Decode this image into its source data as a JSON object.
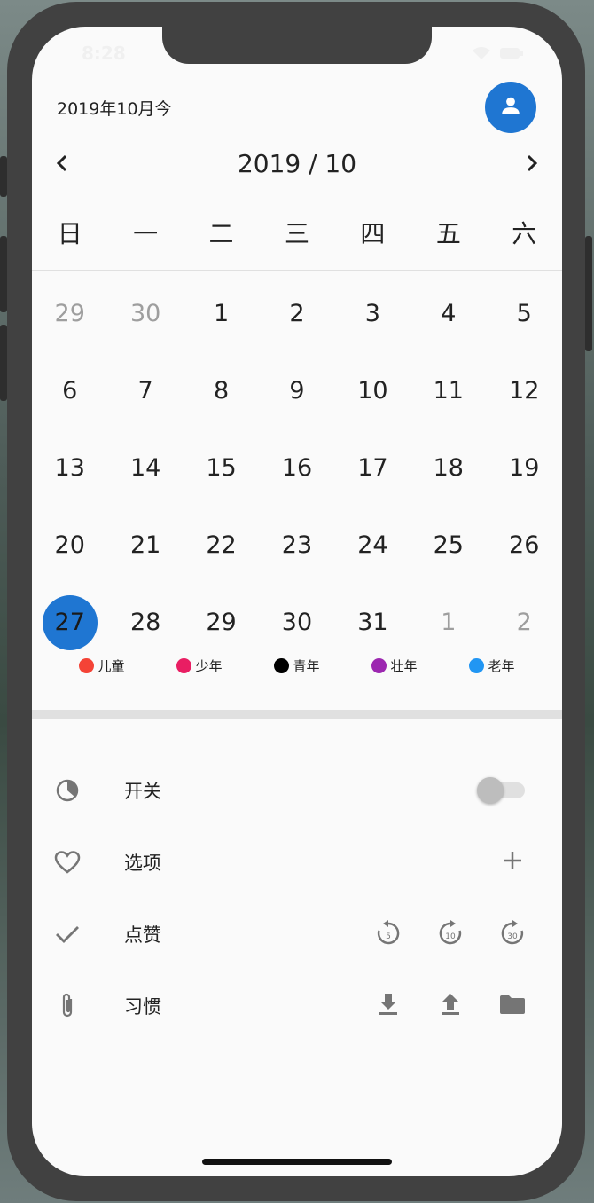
{
  "status": {
    "time": "8:28"
  },
  "header": {
    "date_label": "2019年10月今"
  },
  "nav": {
    "month_title": "2019 / 10"
  },
  "weekdays": [
    "日",
    "一",
    "二",
    "三",
    "四",
    "五",
    "六"
  ],
  "weeks": [
    [
      {
        "d": "29",
        "muted": true
      },
      {
        "d": "30",
        "muted": true
      },
      {
        "d": "1"
      },
      {
        "d": "2"
      },
      {
        "d": "3"
      },
      {
        "d": "4"
      },
      {
        "d": "5"
      }
    ],
    [
      {
        "d": "6"
      },
      {
        "d": "7"
      },
      {
        "d": "8"
      },
      {
        "d": "9"
      },
      {
        "d": "10"
      },
      {
        "d": "11"
      },
      {
        "d": "12"
      }
    ],
    [
      {
        "d": "13"
      },
      {
        "d": "14"
      },
      {
        "d": "15"
      },
      {
        "d": "16"
      },
      {
        "d": "17"
      },
      {
        "d": "18"
      },
      {
        "d": "19"
      }
    ],
    [
      {
        "d": "20"
      },
      {
        "d": "21"
      },
      {
        "d": "22"
      },
      {
        "d": "23"
      },
      {
        "d": "24"
      },
      {
        "d": "25"
      },
      {
        "d": "26"
      }
    ],
    [
      {
        "d": "27",
        "selected": true
      },
      {
        "d": "28"
      },
      {
        "d": "29"
      },
      {
        "d": "30"
      },
      {
        "d": "31"
      },
      {
        "d": "1",
        "muted": true
      },
      {
        "d": "2",
        "muted": true
      }
    ]
  ],
  "legend": [
    {
      "label": "儿童",
      "color": "#f44336"
    },
    {
      "label": "少年",
      "color": "#e91e63"
    },
    {
      "label": "青年",
      "color": "#000000"
    },
    {
      "label": "壮年",
      "color": "#9c27b0"
    },
    {
      "label": "老年",
      "color": "#2196f3"
    }
  ],
  "list": {
    "switch_label": "开关",
    "switch_on": false,
    "options_label": "选项",
    "like_label": "点赞",
    "habit_label": "习惯",
    "replay_5": "5",
    "forward_10": "10",
    "forward_30": "30"
  },
  "colors": {
    "accent": "#1f76d2",
    "icon_gray": "#757575"
  }
}
